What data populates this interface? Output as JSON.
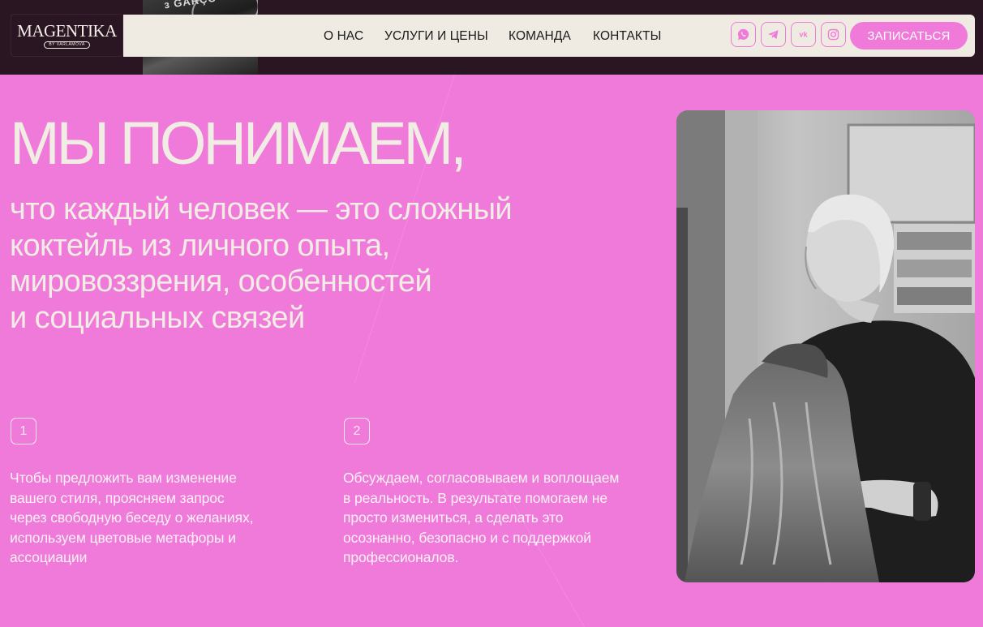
{
  "logo": {
    "name": "MAGENTIKA",
    "sub": "BY VARLAMOVA"
  },
  "header": {
    "strip_photo_text": "з GARÇO",
    "nav": [
      "О НАС",
      "УСЛУГИ И ЦЕНЫ",
      "КОМАНДА",
      "КОНТАКТЫ"
    ],
    "socials": [
      {
        "icon": "whatsapp-icon"
      },
      {
        "icon": "telegram-icon"
      },
      {
        "icon": "vk-icon",
        "text": "vk"
      },
      {
        "icon": "instagram-icon"
      }
    ],
    "cta_label": "ЗАПИСАТЬСЯ"
  },
  "hero": {
    "title": "МЫ ПОНИМАЕМ,",
    "subtitle": "что каждый человек — это сложный\nкоктейль из личного опыта,\nмировоззрения, особенностей\nи социальных связей"
  },
  "steps": [
    {
      "number": "1",
      "text": "Чтобы предложить вам изменение\nвашего стиля, проясняем запрос\nчерез свободную беседу о желаниях,\nиспользуем цветовые метафоры и\nассоциации"
    },
    {
      "number": "2",
      "text": "Обсуждаем, согласовываем и воплощаем\nв реальность. В результате помогаем не\nпросто измениться, а сделать это\nосознанно, безопасно и с поддержкой\nпрофессионалов."
    }
  ],
  "colors": {
    "accent": "#f07ad9",
    "dark": "#2a1622",
    "nav_bg": "#efebe3",
    "hero_text": "#f1ece4"
  }
}
